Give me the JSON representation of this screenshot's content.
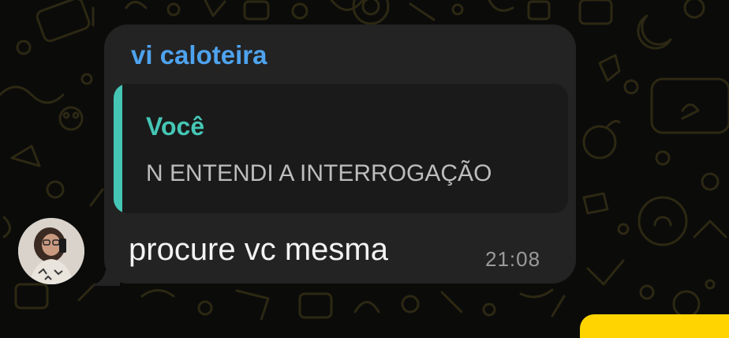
{
  "chat": {
    "background_color": "#0b0b0a",
    "doodle_color": "#2c2813"
  },
  "message": {
    "sender_name": "vi caloteira",
    "sender_name_color": "#4ea3ee",
    "reply_to": {
      "author": "Você",
      "text": "N ENTENDI A INTERROGAÇÃO",
      "accent_color": "#45c6b5"
    },
    "text": "procure vc mesma",
    "time": "21:08",
    "bubble_color": "#232323"
  },
  "next_message_color": "#ffd400",
  "icons": {
    "avatar": "contact-avatar-photo"
  }
}
